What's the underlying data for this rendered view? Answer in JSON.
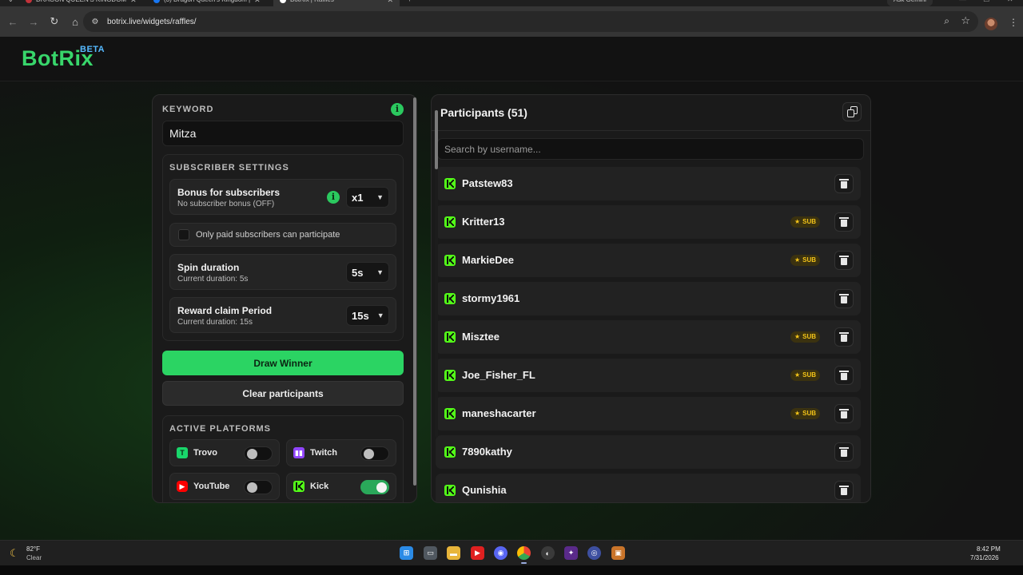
{
  "browser": {
    "tabs": [
      {
        "title": "DRAGON QUEEN'S KINGDOM",
        "favicon_color": "#c2323a"
      },
      {
        "title": "(3) Dragon Queen's Kingdom |",
        "favicon_color": "#1877f2"
      },
      {
        "title": "BotRix | Raffles",
        "favicon_color": "#ffffff"
      }
    ],
    "new_tab": "+",
    "ask_gemini": "Ask Gemini",
    "url": "botrix.live/widgets/raffles/"
  },
  "app": {
    "logo": "BotRix",
    "beta": "BETA",
    "accent": "#2bd463"
  },
  "keyword": {
    "label": "KEYWORD",
    "value": "Mitza",
    "info": "i"
  },
  "subscriber_settings": {
    "title": "SUBSCRIBER SETTINGS",
    "bonus": {
      "title": "Bonus for subscribers",
      "subtitle": "No subscriber bonus (OFF)",
      "info": "i",
      "value": "x1"
    },
    "paid_only": {
      "label": "Only paid subscribers can participate",
      "checked": false
    },
    "spin": {
      "title": "Spin duration",
      "subtitle": "Current duration: 5s",
      "value": "5s"
    },
    "reward": {
      "title": "Reward claim Period",
      "subtitle": "Current duration: 15s",
      "value": "15s"
    }
  },
  "buttons": {
    "draw": "Draw Winner",
    "clear": "Clear participants"
  },
  "platforms": {
    "title": "ACTIVE PLATFORMS",
    "items": [
      {
        "name": "Trovo",
        "enabled": false,
        "color": "#19d66b"
      },
      {
        "name": "Twitch",
        "enabled": false,
        "color": "#9146ff"
      },
      {
        "name": "YouTube",
        "enabled": false,
        "color": "#ff0000"
      },
      {
        "name": "Kick",
        "enabled": true,
        "color": "#53fc18"
      }
    ]
  },
  "participants": {
    "title": "Participants (51)",
    "search_placeholder": "Search by username...",
    "sub_label": "SUB",
    "items": [
      {
        "name": "Patstew83",
        "sub": false
      },
      {
        "name": "Kritter13",
        "sub": true
      },
      {
        "name": "MarkieDee",
        "sub": true
      },
      {
        "name": "stormy1961",
        "sub": false
      },
      {
        "name": "Misztee",
        "sub": true
      },
      {
        "name": "Joe_Fisher_FL",
        "sub": true
      },
      {
        "name": "maneshacarter",
        "sub": true
      },
      {
        "name": "7890kathy",
        "sub": false
      },
      {
        "name": "Qunishia",
        "sub": false
      }
    ]
  },
  "taskbar": {
    "weather_temp": "82°F",
    "weather_desc": "Clear",
    "time": "8:42 PM",
    "date": "7/31/2026"
  }
}
